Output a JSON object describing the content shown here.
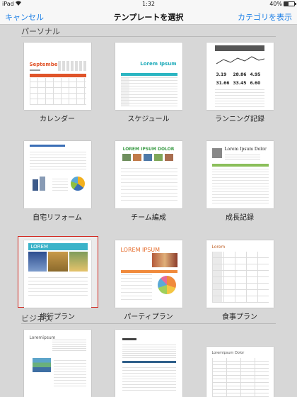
{
  "status_bar": {
    "device": "iPad",
    "time": "1:32",
    "battery": "40%"
  },
  "nav": {
    "cancel_label": "キャンセル",
    "title": "テンプレートを選択",
    "categories_label": "カテゴリを表示"
  },
  "sections": [
    {
      "header": "パーソナル",
      "templates": [
        {
          "label": "カレンダー",
          "thumb_title": "September"
        },
        {
          "label": "スケジュール",
          "thumb_title": "Lorem Ipsum"
        },
        {
          "label": "ランニング記録",
          "thumb_values": [
            "3.19",
            "28.86",
            "4.95",
            "31.66",
            "33.45",
            "6.60"
          ]
        },
        {
          "label": "自宅リフォーム"
        },
        {
          "label": "チーム編成",
          "thumb_title": "LOREM IPSUM DOLOR"
        },
        {
          "label": "成長記録",
          "thumb_title": "Lorem Ipsum Dolor"
        },
        {
          "label": "旅行プラン",
          "thumb_title": "LOREM",
          "selected": true
        },
        {
          "label": "パーティプラン",
          "thumb_title": "LOREM IPSUM"
        },
        {
          "label": "食事プラン",
          "thumb_title": "Lorem"
        }
      ]
    },
    {
      "header": "ビジネス",
      "templates": [
        {
          "label": "",
          "thumb_title": "Loremipsum"
        },
        {
          "label": ""
        },
        {
          "label": "",
          "thumb_title": "Loremipsum Dolor"
        }
      ]
    }
  ],
  "colors": {
    "accent": "#1a7ee6",
    "selection": "#d2261f"
  }
}
